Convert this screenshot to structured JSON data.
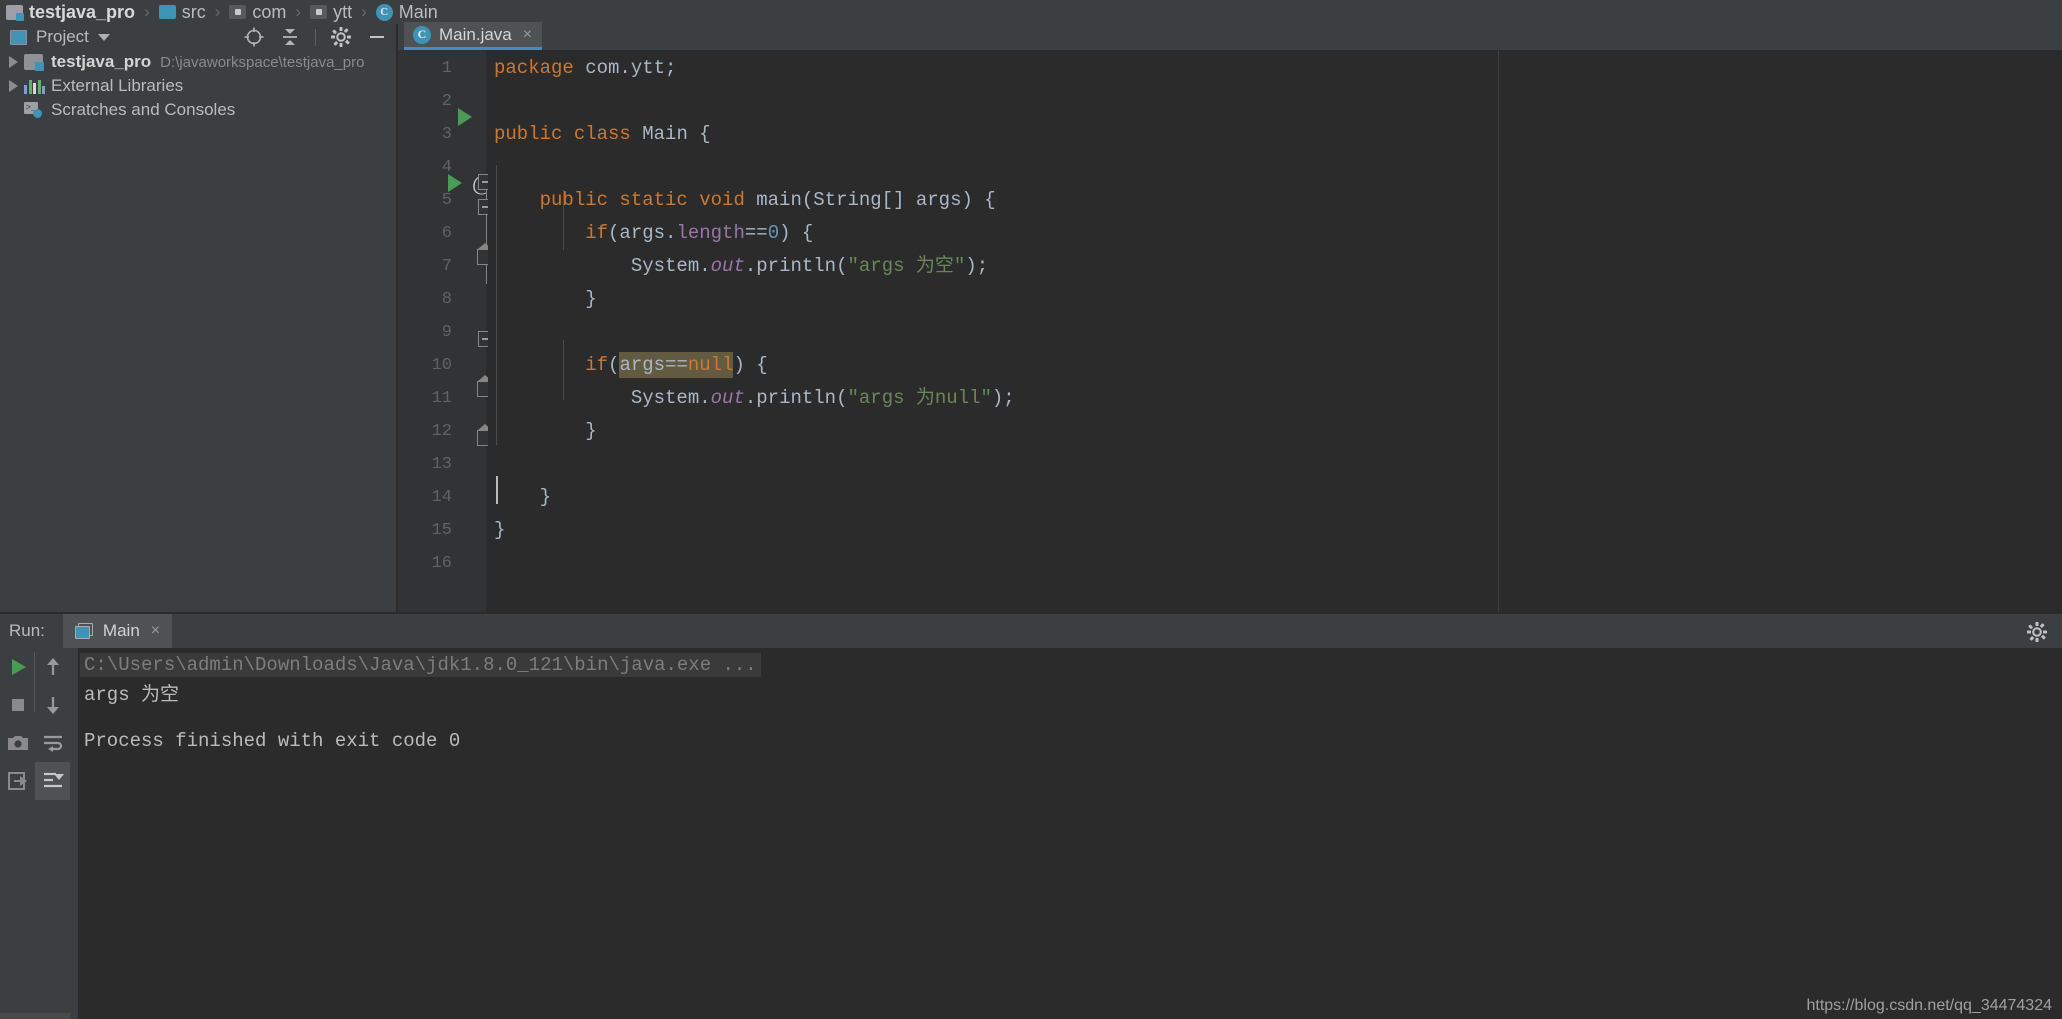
{
  "breadcrumb": {
    "items": [
      {
        "label": "testjava_pro",
        "icon": "module-icon",
        "bold": true
      },
      {
        "label": "src",
        "icon": "source-folder-icon",
        "bold": false
      },
      {
        "label": "com",
        "icon": "package-icon",
        "bold": false
      },
      {
        "label": "ytt",
        "icon": "package-icon",
        "bold": false
      },
      {
        "label": "Main",
        "icon": "java-class-icon",
        "bold": false
      }
    ],
    "separator": "›"
  },
  "project_panel": {
    "title": "Project",
    "caret": "▾",
    "tools": [
      {
        "name": "locate-icon",
        "label": ""
      },
      {
        "name": "collapse-all-icon",
        "label": ""
      },
      {
        "name": "gear-icon",
        "label": ""
      },
      {
        "name": "hide-icon",
        "label": "—"
      }
    ],
    "tree": [
      {
        "label": "testjava_pro",
        "sub": "D:\\javaworkspace\\testjava_pro",
        "icon": "module-icon",
        "bold": true,
        "expandable": true
      },
      {
        "label": "External Libraries",
        "sub": "",
        "icon": "library-icon",
        "bold": false,
        "expandable": true
      },
      {
        "label": "Scratches and Consoles",
        "sub": "",
        "icon": "scratches-icon",
        "bold": false,
        "expandable": false
      }
    ]
  },
  "editor": {
    "tab": {
      "label": "Main.java",
      "icon": "java-class-icon",
      "close": "×"
    },
    "lines": [
      {
        "num": "1",
        "tokens": [
          {
            "t": "package ",
            "c": "k"
          },
          {
            "t": "com.ytt;",
            "c": "pl"
          }
        ]
      },
      {
        "num": "2",
        "tokens": []
      },
      {
        "num": "3",
        "tokens": [
          {
            "t": "public class ",
            "c": "k"
          },
          {
            "t": "Main ",
            "c": "pl"
          },
          {
            "t": "{",
            "c": "pl"
          }
        ]
      },
      {
        "num": "4",
        "tokens": []
      },
      {
        "num": "5",
        "tokens": [
          {
            "t": "    public static void ",
            "c": "k"
          },
          {
            "t": "main",
            "c": "plb"
          },
          {
            "t": "(String[] args) {",
            "c": "pl"
          }
        ]
      },
      {
        "num": "6",
        "tokens": [
          {
            "t": "        if",
            "c": "k"
          },
          {
            "t": "(args.",
            "c": "pl"
          },
          {
            "t": "length",
            "c": "fld"
          },
          {
            "t": "==",
            "c": "pl"
          },
          {
            "t": "0",
            "c": "num"
          },
          {
            "t": ") {",
            "c": "pl"
          }
        ]
      },
      {
        "num": "7",
        "tokens": [
          {
            "t": "            System.",
            "c": "pl"
          },
          {
            "t": "out",
            "c": "stat"
          },
          {
            "t": ".println(",
            "c": "pl"
          },
          {
            "t": "\"args 为空\"",
            "c": "str"
          },
          {
            "t": ");",
            "c": "pl"
          }
        ]
      },
      {
        "num": "8",
        "tokens": [
          {
            "t": "        }",
            "c": "pl"
          }
        ]
      },
      {
        "num": "9",
        "tokens": []
      },
      {
        "num": "10",
        "tokens": [
          {
            "t": "        if",
            "c": "k"
          },
          {
            "t": "(",
            "c": "pl"
          },
          {
            "t": "args==",
            "c": "pl-sel"
          },
          {
            "t": "null",
            "c": "k-sel"
          },
          {
            "t": ") {",
            "c": "pl"
          }
        ]
      },
      {
        "num": "11",
        "tokens": [
          {
            "t": "            System.",
            "c": "pl"
          },
          {
            "t": "out",
            "c": "stat"
          },
          {
            "t": ".println(",
            "c": "pl"
          },
          {
            "t": "\"args 为null\"",
            "c": "str"
          },
          {
            "t": ");",
            "c": "pl"
          }
        ]
      },
      {
        "num": "12",
        "tokens": [
          {
            "t": "        }",
            "c": "pl"
          }
        ]
      },
      {
        "num": "13",
        "tokens": []
      },
      {
        "num": "14",
        "tokens": [
          {
            "t": "    }",
            "c": "pl"
          }
        ]
      },
      {
        "num": "15",
        "tokens": [
          {
            "t": "}",
            "c": "pl"
          }
        ]
      },
      {
        "num": "16",
        "tokens": []
      }
    ],
    "gutter_markers": {
      "run_class_line": "3",
      "run_method_line": "5",
      "annotation_line": "5"
    },
    "colors": {
      "keyword": "#cc7832",
      "string": "#6a8759",
      "number": "#6897bb",
      "field": "#9876aa",
      "plain": "#a9b7c6",
      "selection": "#625b41",
      "background": "#2b2b2b",
      "gutter": "#313335"
    }
  },
  "run_panel": {
    "label": "Run:",
    "tab": {
      "label": "Main",
      "icon": "run-config-icon",
      "close": "×"
    },
    "gear": "gear-icon",
    "toolbar": [
      {
        "name": "rerun-button",
        "icon": "play-icon"
      },
      {
        "name": "stop-button",
        "icon": "stop-icon"
      },
      {
        "name": "screenshot-button",
        "icon": "camera-icon"
      },
      {
        "name": "export-button",
        "icon": "export-icon"
      },
      {
        "name": "up-stack-button",
        "icon": "arrow-up-icon"
      },
      {
        "name": "down-stack-button",
        "icon": "arrow-down-icon"
      },
      {
        "name": "soft-wrap-button",
        "icon": "wrap-icon"
      },
      {
        "name": "scroll-to-end-button",
        "icon": "scroll-end-icon"
      }
    ],
    "console": [
      {
        "text": "C:\\Users\\admin\\Downloads\\Java\\jdk1.8.0_121\\bin\\java.exe ...",
        "style": "dim"
      },
      {
        "text": "args 为空",
        "style": "normal"
      },
      {
        "text": "",
        "style": "normal"
      },
      {
        "text": "Process finished with exit code 0",
        "style": "normal"
      }
    ]
  },
  "watermark": "https://blog.csdn.net/qq_34474324"
}
